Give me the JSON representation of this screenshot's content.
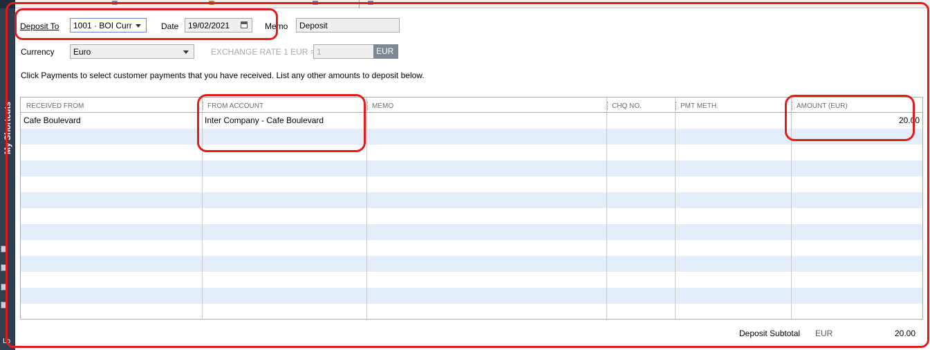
{
  "sidebar": {
    "title": "My Shortcuts",
    "footer_text": "Lo"
  },
  "form": {
    "deposit_to_label": "Deposit To",
    "deposit_to_value": "1001 · BOI Curr",
    "date_label": "Date",
    "date_value": "19/02/2021",
    "memo_label": "Memo",
    "memo_value": "Deposit",
    "currency_label": "Currency",
    "currency_value": "Euro",
    "exchange_rate_label": "EXCHANGE RATE 1 EUR =",
    "exchange_rate_value": "1",
    "exchange_rate_currency": "EUR"
  },
  "instruction": "Click Payments to select customer payments that you have received. List any other amounts to deposit below.",
  "table": {
    "columns": [
      "RECEIVED FROM",
      "FROM ACCOUNT",
      "MEMO",
      "CHQ NO.",
      "PMT METH.",
      "AMOUNT (EUR)"
    ],
    "rows": [
      {
        "received_from": "Cafe Boulevard",
        "from_account": "Inter Company - Cafe Boulevard",
        "memo": "",
        "chq_no": "",
        "pmt_meth": "",
        "amount": "20.00"
      }
    ]
  },
  "footer": {
    "subtotal_label": "Deposit Subtotal",
    "subtotal_currency": "EUR",
    "subtotal_value": "20.00"
  },
  "colors": {
    "annotation_red": "#e01b1b",
    "row_stripe": "#e3edf9",
    "sidebar": "#2e3f52"
  }
}
